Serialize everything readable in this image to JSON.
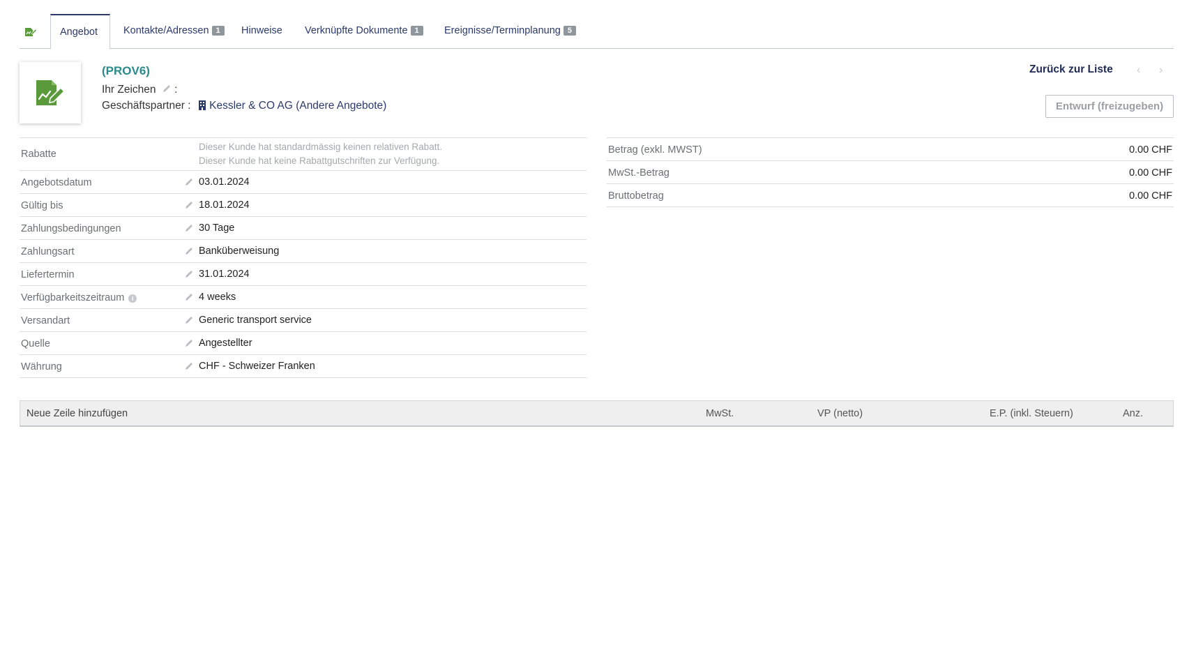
{
  "tabs": [
    {
      "label": "Angebot",
      "badge": ""
    },
    {
      "label": "Kontakte/Adressen",
      "badge": "1"
    },
    {
      "label": "Hinweise",
      "badge": ""
    },
    {
      "label": "Verknüpfte Dokumente",
      "badge": "1"
    },
    {
      "label": "Ereignisse/Terminplanung",
      "badge": "5"
    }
  ],
  "header": {
    "code": "(PROV6)",
    "reference_label": "Ihr Zeichen",
    "partner_label": "Geschäftspartner :",
    "partner_name": "Kessler & CO AG",
    "partner_other": "(Andere Angebote)",
    "back_label": "Zurück zur Liste",
    "prev_arrow": "‹",
    "next_arrow": "›",
    "status_button": "Entwurf (freizugeben)"
  },
  "fields": {
    "rabatte_label": "Rabatte",
    "rabatte_note1": "Dieser Kunde hat standardmässig keinen relativen Rabatt.",
    "rabatte_note2": "Dieser Kunde hat keine Rabattgutschriften zur Verfügung.",
    "rows": [
      {
        "label": "Angebotsdatum",
        "value": "03.01.2024"
      },
      {
        "label": "Gültig bis",
        "value": "18.01.2024"
      },
      {
        "label": "Zahlungsbedingungen",
        "value": "30 Tage"
      },
      {
        "label": "Zahlungsart",
        "value": "Banküberweisung"
      },
      {
        "label": "Liefertermin",
        "value": "31.01.2024"
      },
      {
        "label": "Verfügbarkeitszeitraum",
        "value": "4 weeks"
      },
      {
        "label": "Versandart",
        "value": "Generic transport service"
      },
      {
        "label": "Quelle",
        "value": "Angestellter"
      },
      {
        "label": "Währung",
        "value": "CHF - Schweizer Franken"
      }
    ]
  },
  "totals": [
    {
      "label": "Betrag (exkl. MWST)",
      "value": "0.00 CHF"
    },
    {
      "label": "MwSt.-Betrag",
      "value": "0.00 CHF"
    },
    {
      "label": "Bruttobetrag",
      "value": "0.00 CHF"
    }
  ],
  "lines": {
    "add_label": "Neue Zeile hinzufügen",
    "columns": [
      "MwSt.",
      "VP (netto)",
      "E.P. (inkl. Steuern)",
      "Anz."
    ]
  },
  "colors": {
    "accent": "#2b3a6b",
    "code": "#2a8a8c",
    "icon_green": "#5a9a3a",
    "badge": "#8f969c"
  }
}
